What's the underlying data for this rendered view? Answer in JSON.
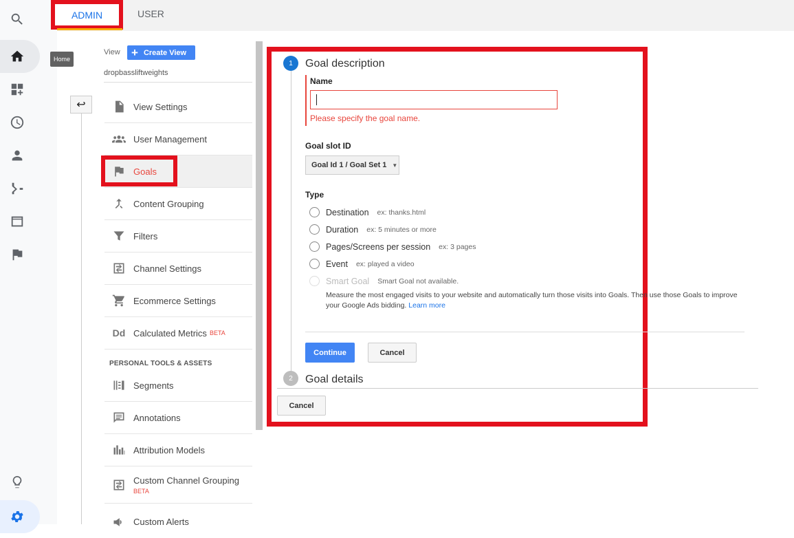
{
  "rail": {
    "tooltip": "Home",
    "icons": [
      "search-icon",
      "home-icon",
      "customization-icon",
      "realtime-clock-icon",
      "audience-person-icon",
      "acquisition-icon",
      "behavior-icon",
      "conversions-flag-icon",
      "discover-lightbulb-icon",
      "admin-gear-icon"
    ]
  },
  "tabs": {
    "admin": "ADMIN",
    "user": "USER"
  },
  "view": {
    "label": "View",
    "create_button": "Create View",
    "name": "dropbassliftweights"
  },
  "nav": {
    "items": [
      {
        "label": "View Settings",
        "icon": "document-icon"
      },
      {
        "label": "User Management",
        "icon": "people-icon"
      },
      {
        "label": "Goals",
        "icon": "flag-icon",
        "active": true
      },
      {
        "label": "Content Grouping",
        "icon": "merge-icon"
      },
      {
        "label": "Filters",
        "icon": "filter-icon"
      },
      {
        "label": "Channel Settings",
        "icon": "channel-icon"
      },
      {
        "label": "Ecommerce Settings",
        "icon": "cart-icon"
      },
      {
        "label": "Calculated Metrics",
        "icon": "dd-icon",
        "badge": "BETA"
      }
    ],
    "section_title": "PERSONAL TOOLS & ASSETS",
    "tools": [
      {
        "label": "Segments",
        "icon": "segments-icon"
      },
      {
        "label": "Annotations",
        "icon": "annotation-icon"
      },
      {
        "label": "Attribution Models",
        "icon": "attribution-icon"
      },
      {
        "label": "Custom Channel Grouping",
        "icon": "channel-icon",
        "badge": "BETA"
      },
      {
        "label": "Custom Alerts",
        "icon": "megaphone-icon"
      }
    ]
  },
  "form": {
    "step1": {
      "num": "1",
      "title": "Goal description"
    },
    "name_label": "Name",
    "name_value": "",
    "name_error": "Please specify the goal name.",
    "slot_label": "Goal slot ID",
    "slot_value": "Goal Id 1 / Goal Set 1",
    "type_label": "Type",
    "types": [
      {
        "label": "Destination",
        "example": "ex: thanks.html"
      },
      {
        "label": "Duration",
        "example": "ex: 5 minutes or more"
      },
      {
        "label": "Pages/Screens per session",
        "example": "ex: 3 pages"
      },
      {
        "label": "Event",
        "example": "ex: played a video"
      },
      {
        "label": "Smart Goal",
        "example": "Smart Goal not available.",
        "disabled": true
      }
    ],
    "smart_desc": "Measure the most engaged visits to your website and automatically turn those visits into Goals. Then use those Goals to improve your Google Ads bidding.",
    "learn_more": "Learn more",
    "continue": "Continue",
    "cancel": "Cancel",
    "step2": {
      "num": "2",
      "title": "Goal details"
    },
    "bottom_cancel": "Cancel"
  }
}
